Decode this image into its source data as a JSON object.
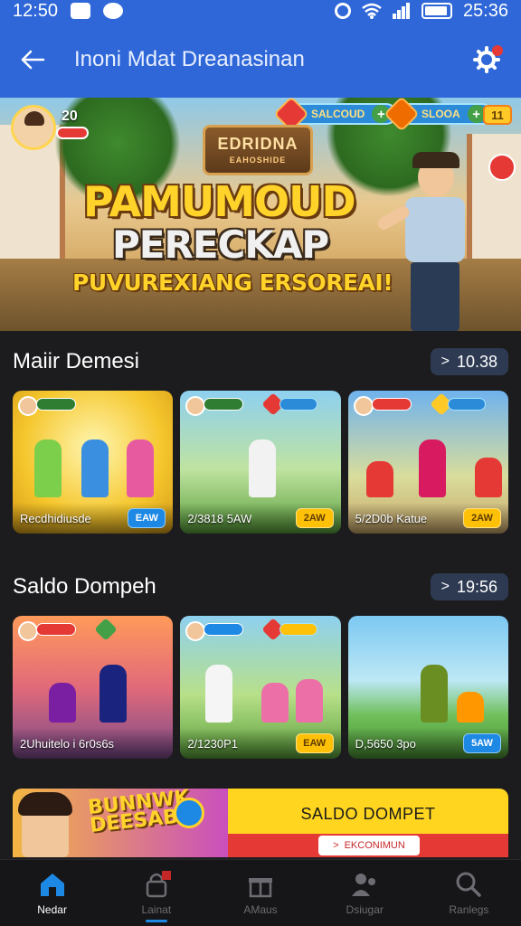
{
  "status_bar": {
    "time": "12:50",
    "right_time": "25:36"
  },
  "app_bar": {
    "title": "Inoni Mdat Dreanasinan"
  },
  "hero": {
    "level": "20",
    "currency_1": "SALCOUD",
    "currency_2": "SLOOA",
    "coins": "11",
    "emblem_title": "EDRIDNA",
    "emblem_sub": "EAHOSHIDE",
    "line1": "PAMUMOUD",
    "line2": "PERECKAP",
    "line3": "PUVUREXIANG ERSOREAI!"
  },
  "sections": [
    {
      "title": "Maiir Demesi",
      "timer": "10.38",
      "cards": [
        {
          "caption": "Recdhidiusde",
          "button": "EAW",
          "button_style": "blue"
        },
        {
          "caption": "2/3818 5AW",
          "button": "2AW",
          "button_style": "yellow"
        },
        {
          "caption": "5/2D0b Katue",
          "button": "2AW",
          "button_style": "yellow"
        }
      ]
    },
    {
      "title": "Saldo Dompeh",
      "timer": "19:56",
      "cards": [
        {
          "caption": "2Uhuitelo i 6r0s6s",
          "button": "",
          "button_style": "none"
        },
        {
          "caption": "2/1230P1",
          "button": "EAW",
          "button_style": "yellow"
        },
        {
          "caption": "D,5650 3po",
          "button": "5AW",
          "button_style": "blue"
        }
      ]
    }
  ],
  "promo": {
    "art_text": "BUNNWK DEESABI",
    "title": "SALDO DOMPET",
    "button": "EKCONIMUN"
  },
  "bottom_nav": [
    {
      "label": "Nedar",
      "icon": "home-icon",
      "active": true
    },
    {
      "label": "Lainat",
      "icon": "lock-icon",
      "active": false
    },
    {
      "label": "AMaus",
      "icon": "gift-icon",
      "active": false
    },
    {
      "label": "Dsiugar",
      "icon": "people-icon",
      "active": false
    },
    {
      "label": "Ranlegs",
      "icon": "search-icon",
      "active": false
    }
  ],
  "colors": {
    "primary": "#2f67d8",
    "background": "#1c1c1e",
    "accent": "#ffc107"
  }
}
